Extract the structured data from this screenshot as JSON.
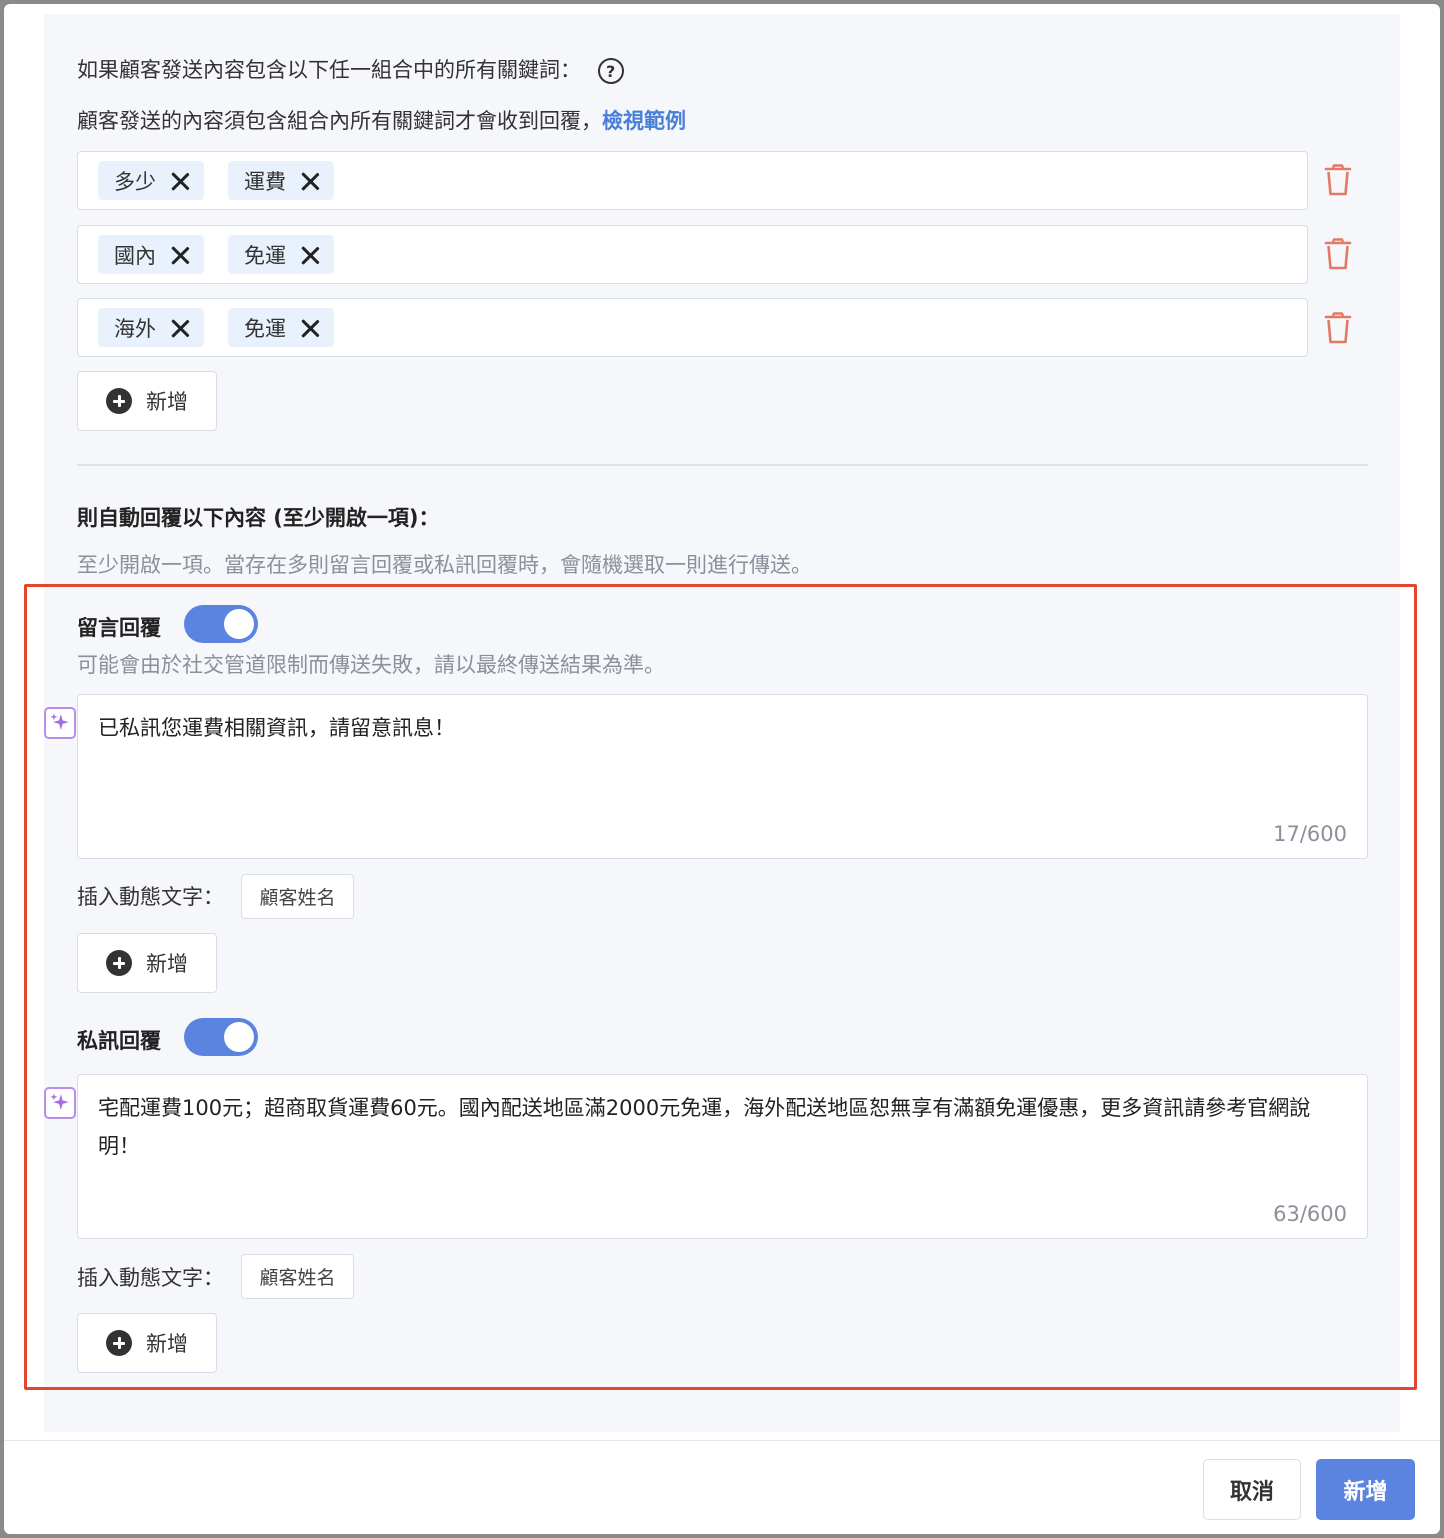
{
  "condition": {
    "title": "如果顧客發送內容包含以下任一組合中的所有關鍵詞：",
    "help_icon": "question-circle-icon",
    "desc": "顧客發送的內容須包含組合內所有關鍵詞才會收到回覆，",
    "desc_link": "檢視範例",
    "groups": [
      {
        "keywords": [
          "多少",
          "運費"
        ]
      },
      {
        "keywords": [
          "國內",
          "免運"
        ]
      },
      {
        "keywords": [
          "海外",
          "免運"
        ]
      }
    ],
    "add_label": "新增"
  },
  "reply": {
    "title": "則自動回覆以下內容 (至少開啟一項)：",
    "desc": "至少開啟一項。當存在多則留言回覆或私訊回覆時，會隨機選取一則進行傳送。"
  },
  "comment_reply": {
    "label": "留言回覆",
    "enabled": true,
    "note": "可能會由於社交管道限制而傳送失敗，請以最終傳送結果為準。",
    "message": "已私訊您運費相關資訊，請留意訊息！",
    "count": "17/600",
    "dyn_label": "插入動態文字：",
    "dyn_chip": "顧客姓名",
    "add_label": "新增"
  },
  "dm_reply": {
    "label": "私訊回覆",
    "enabled": true,
    "message": "宅配運費100元；超商取貨運費60元。國內配送地區滿2000元免運，海外配送地區恕無享有滿額免運優惠，更多資訊請參考官網說明！",
    "count": "63/600",
    "dyn_label": "插入動態文字：",
    "dyn_chip": "顧客姓名",
    "add_label": "新增"
  },
  "footer": {
    "cancel": "取消",
    "submit": "新增"
  },
  "colors": {
    "accent": "#5b84e0",
    "link": "#4a7fd8",
    "delete": "#e07a63",
    "highlight": "#e4452e"
  }
}
